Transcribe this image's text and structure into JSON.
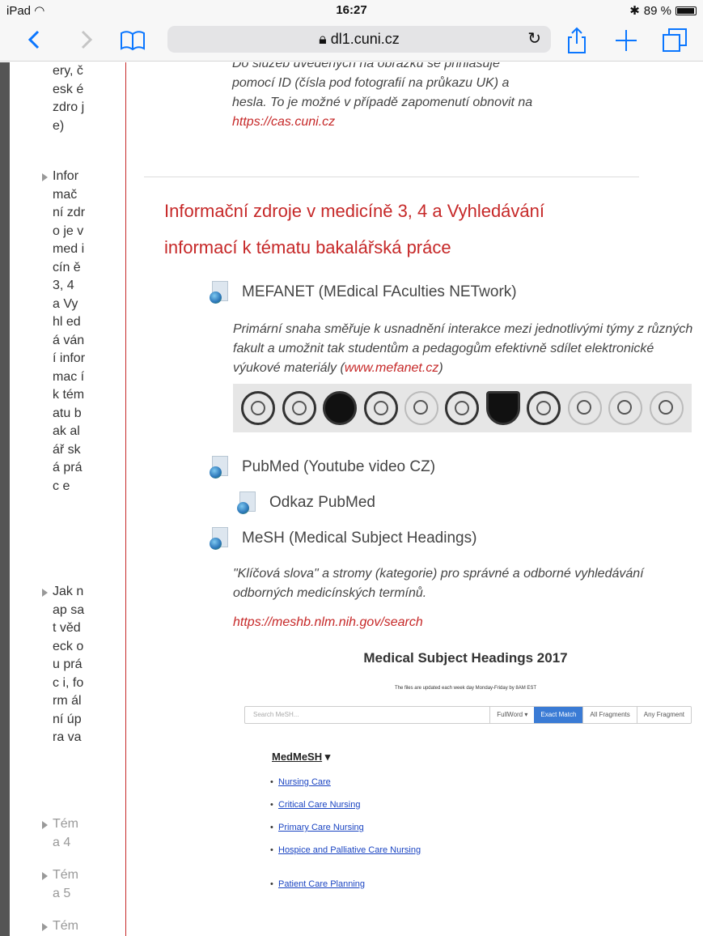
{
  "status": {
    "device": "iPad",
    "time": "16:27",
    "battery": "89 %"
  },
  "browser": {
    "domain": "dl1.cuni.cz"
  },
  "sidebar": {
    "item0": "ery, česk é zdro je)",
    "item1": "Infor mač ní zdro je v med icín ě 3, 4 a Vyhl edá vání infor mac í k tém atu bak alář ská prác e",
    "item2": "Jak nap sat věd eck ou prác i, form ální úpra va",
    "item3": "Tém a 4",
    "item4": "Tém a 5",
    "item5": "Tém"
  },
  "content": {
    "intro_text": "Do služeb uvedených na obrázku se přihlašuje pomocí ID (čísla pod fotografií na průkazu UK) a hesla. To je možné v případě zapomenutí obnovit na ",
    "intro_link": "https://cas.cuni.cz",
    "heading_line1": "Informační zdroje v medicíně 3, 4 a Vyhledávání",
    "heading_line2": "informací k tématu bakalářská práce",
    "mefanet_title": "MEFANET (MEdical FAculties NETwork)",
    "mefanet_desc": "Primární snaha směřuje k usnadnění interakce mezi jednotlivými týmy z různých fakult a umožnit tak studentům a pedagogům efektivně sdílet elektronické výukové materiály (",
    "mefanet_link": "www.mefanet.cz",
    "mefanet_desc_end": ")",
    "pubmed_title": "PubMed (Youtube video CZ)",
    "odkaz_title": "Odkaz PubMed",
    "mesh_title": "MeSH (Medical Subject Headings)",
    "mesh_desc": "\"Klíčová slova\" a stromy (kategorie) pro správné a odborné vyhledávání odborných medicínských termínů.",
    "mesh_link": "https://meshb.nlm.nih.gov/search"
  },
  "mesh_image": {
    "title": "Medical Subject Headings 2017",
    "subtitle": "The files are updated each week day Monday-Friday by 8AM EST",
    "search_placeholder": "Search MeSH...",
    "fullword": "FullWord ▾",
    "exact": "Exact Match",
    "all": "All Fragments",
    "any": "Any Fragment",
    "medmesh": "MedMeSH",
    "links": [
      "Nursing Care",
      "Critical Care Nursing",
      "Primary Care Nursing",
      "Hospice and Palliative Care Nursing",
      "Patient Care Planning"
    ]
  }
}
